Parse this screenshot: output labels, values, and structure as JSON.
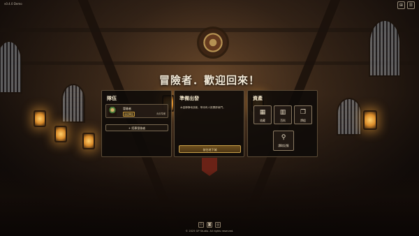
{
  "app": {
    "title": "v0.4.0 Demo"
  },
  "top_icons": [
    {
      "name": "gamepad-icon",
      "glyph": "⊞"
    },
    {
      "name": "menu-icon",
      "glyph": "☰"
    }
  ],
  "welcome": "冒險者．歡迎回來！",
  "party": {
    "title": "隊伍",
    "member": {
      "name": "冒險者",
      "badge": "出征隊伍",
      "status": "尚未準備"
    },
    "recruit_label": "+ 招募冒險者"
  },
  "depart": {
    "title": "準備出發",
    "description": "木盒靜靜地放著，等待有人推開那扇門。",
    "start_label": "前往地下城"
  },
  "assets": {
    "title": "資產",
    "buttons": [
      {
        "label": "收藏",
        "icon": "collection-icon",
        "glyph": "▦"
      },
      {
        "label": "百科",
        "icon": "codex-book-icon",
        "glyph": "▥"
      },
      {
        "label": "牌組",
        "icon": "card-deck-icon",
        "glyph": "❐"
      }
    ],
    "load_label": "讀取記憶",
    "load_glyph": "⚲"
  },
  "footer": {
    "socials": [
      "⚇",
      "◙",
      "◎"
    ],
    "copyright": "© 2025 GP Studio. All rights reserved."
  }
}
